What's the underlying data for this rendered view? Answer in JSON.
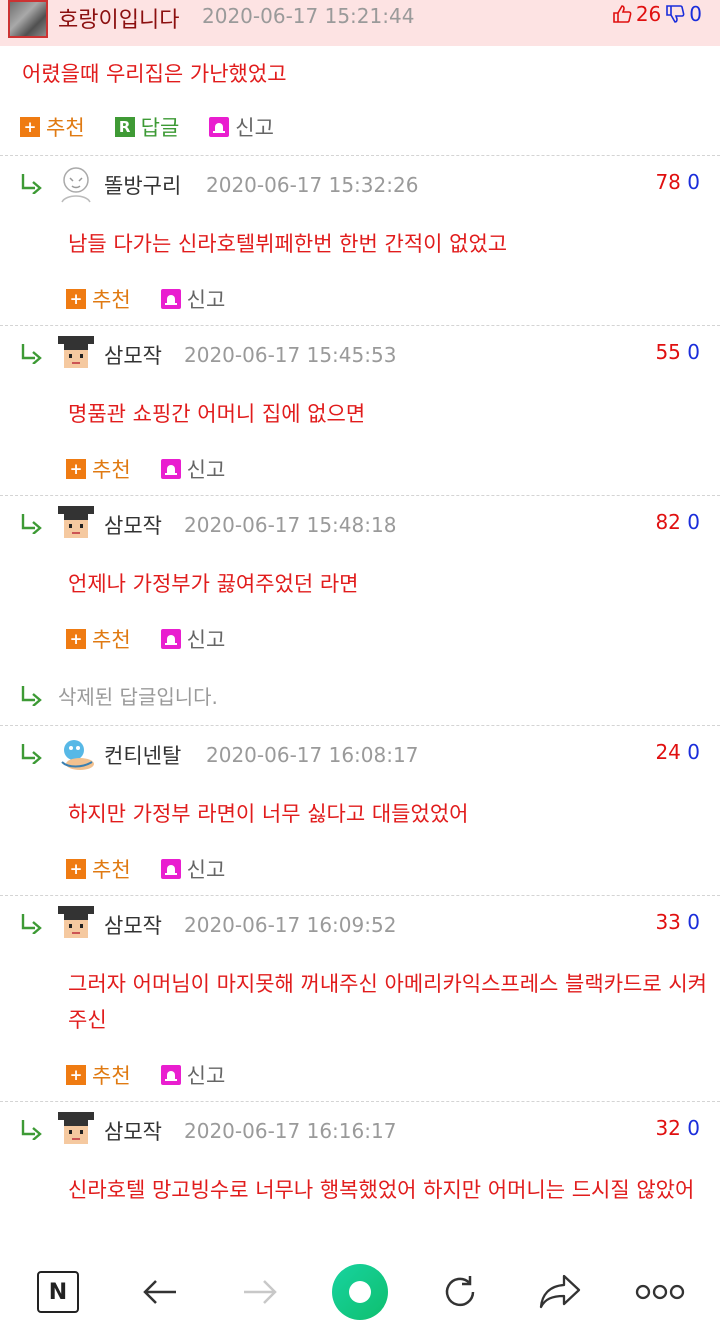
{
  "post": {
    "author": "호랑이입니다",
    "date": "2020-06-17 15:21:44",
    "up": "26",
    "down": "0",
    "body": "어렸을때 우리집은 가난했었고",
    "actions": {
      "recommend": "추천",
      "reply": "답글",
      "report": "신고"
    }
  },
  "comments": [
    {
      "author": "똘방구리",
      "date": "2020-06-17 15:32:26",
      "up": "78",
      "down": "0",
      "body": "남들 다가는 신라호텔뷔페한번 한번 간적이 없었고",
      "recommend": "추천",
      "report": "신고"
    },
    {
      "author": "삼모작",
      "date": "2020-06-17 15:45:53",
      "up": "55",
      "down": "0",
      "body": "명품관 쇼핑간 어머니 집에 없으면",
      "recommend": "추천",
      "report": "신고"
    },
    {
      "author": "삼모작",
      "date": "2020-06-17 15:48:18",
      "up": "82",
      "down": "0",
      "body": "언제나 가정부가 끓여주었던 라면",
      "recommend": "추천",
      "report": "신고"
    },
    {
      "author": "컨티넨탈",
      "date": "2020-06-17 16:08:17",
      "up": "24",
      "down": "0",
      "body": "하지만 가정부 라면이 너무 싫다고 대들었었어",
      "recommend": "추천",
      "report": "신고"
    },
    {
      "author": "삼모작",
      "date": "2020-06-17 16:09:52",
      "up": "33",
      "down": "0",
      "body": "그러자 어머님이 마지못해 꺼내주신 아메리카익스프레스 블랙카드로 시켜주신",
      "recommend": "추천",
      "report": "신고"
    },
    {
      "author": "삼모작",
      "date": "2020-06-17 16:16:17",
      "up": "32",
      "down": "0",
      "body": "신라호텔 망고빙수로 너무나 행복했었어 하지만 어머니는 드시질 않았어"
    }
  ],
  "deleted_reply": "삭제된 답글입니다.",
  "nav": {
    "n_label": "N"
  },
  "colors": {
    "accent": "#e11c1c",
    "up": "#e01010",
    "down": "#1a2ddb",
    "brand_green": "#17d3a0"
  }
}
